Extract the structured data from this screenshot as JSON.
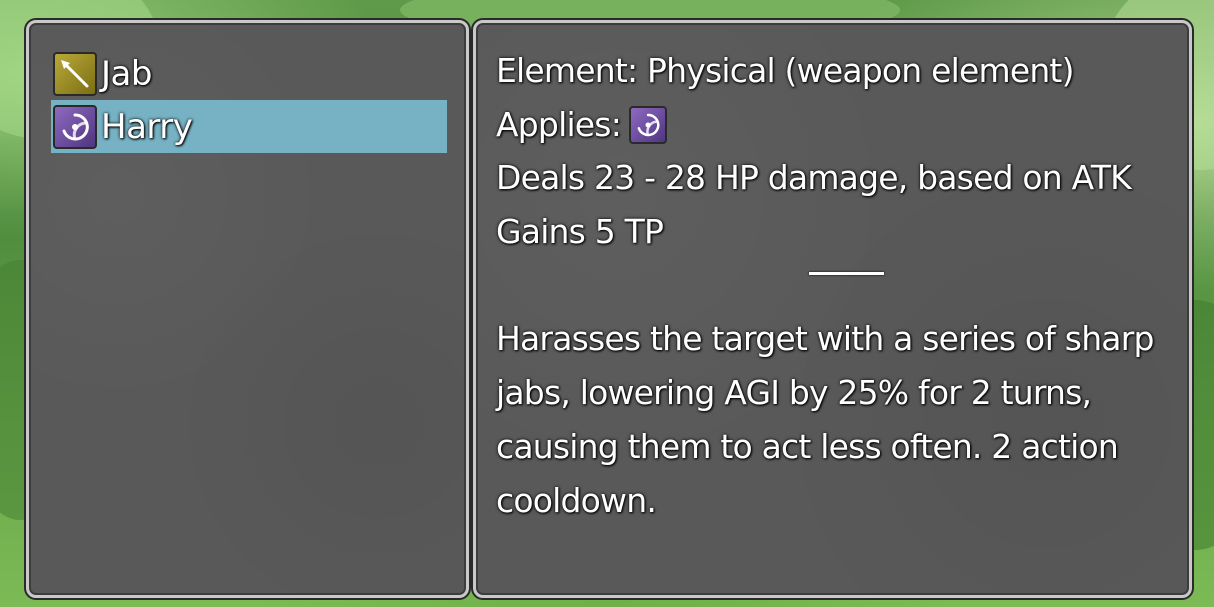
{
  "skill_list": [
    {
      "label": "Jab",
      "icon": "spear-icon",
      "selected": false
    },
    {
      "label": "Harry",
      "icon": "swirl-icon",
      "selected": true
    }
  ],
  "details": {
    "element": "Element: Physical (weapon element)",
    "applies_label": "Applies:",
    "applies_icon": "swirl-icon",
    "damage": "Deals 23 - 28 HP damage, based on ATK",
    "tp": "Gains 5 TP",
    "description_lines": [
      "Harasses the target with a series of sharp",
      "jabs, lowering AGI by 25% for 2 turns,",
      "causing them to act less often. 2 action",
      "cooldown."
    ]
  },
  "colors": {
    "window_bg": "#595959",
    "window_border": "#c9c9c9",
    "selection": "#76b1c4",
    "spear_icon_bg": "#9c8d22",
    "swirl_icon_bg": "#6a4d9a"
  }
}
